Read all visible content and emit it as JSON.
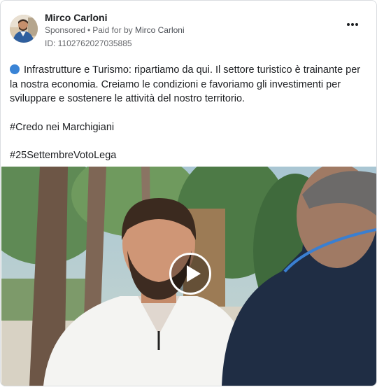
{
  "post": {
    "author": "Mirco Carloni",
    "sponsored_label": "Sponsored",
    "separator": "•",
    "paid_for_label": "Paid for by",
    "payer": "Mirco Carloni",
    "ad_id": "ID: 1102762027035885",
    "more_icon": "more-horizontal-icon",
    "lines": [
      "Infrastrutture e Turismo: ripartiamo da qui. Il settore turistico è trainante per la nostra economia. Creiamo le condizioni e favoriamo gli investimenti per sviluppare e sostenere le attività del nostro territorio.",
      "#Credo nei Marchigiani",
      "#25SettembreVotoLega"
    ],
    "bullet_icon": "blue-circle-icon",
    "bullet_color": "#3a84d6",
    "video": {
      "play_icon": "play-icon"
    }
  }
}
